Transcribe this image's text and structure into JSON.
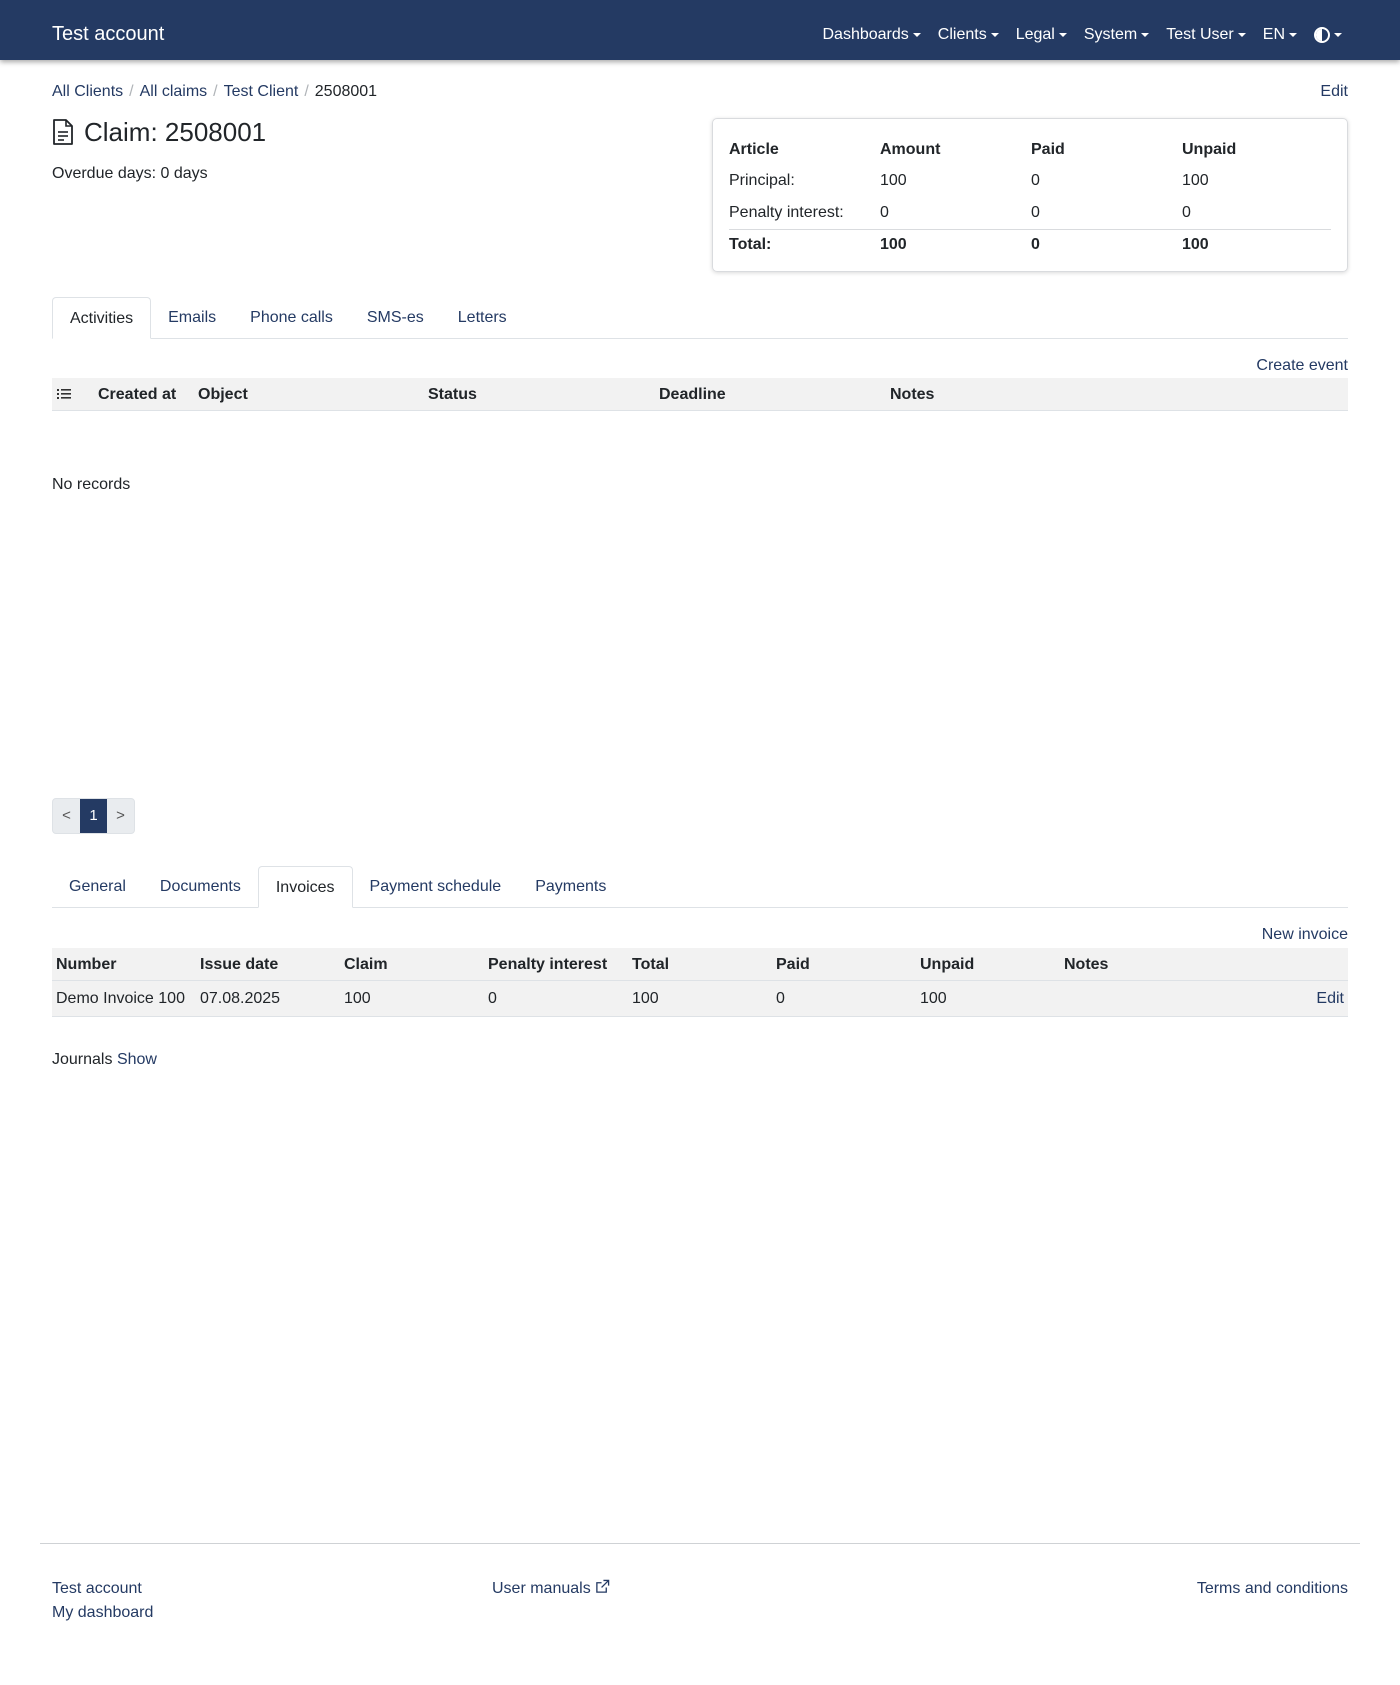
{
  "navbar": {
    "brand": "Test account",
    "items": [
      {
        "label": "Dashboards"
      },
      {
        "label": "Clients"
      },
      {
        "label": "Legal"
      },
      {
        "label": "System"
      },
      {
        "label": "Test User"
      },
      {
        "label": "EN"
      }
    ]
  },
  "breadcrumb": {
    "items": [
      "All Clients",
      "All claims",
      "Test Client"
    ],
    "current": "2508001",
    "separator": "/"
  },
  "edit_label": "Edit",
  "claim": {
    "title": "Claim: 2508001",
    "overdue": "Overdue days: 0 days"
  },
  "summary": {
    "headers": [
      "Article",
      "Amount",
      "Paid",
      "Unpaid"
    ],
    "rows": [
      [
        "Principal:",
        "100",
        "0",
        "100"
      ],
      [
        "Penalty interest:",
        "0",
        "0",
        "0"
      ]
    ],
    "total": [
      "Total:",
      "100",
      "0",
      "100"
    ]
  },
  "activity_tabs": [
    "Activities",
    "Emails",
    "Phone calls",
    "SMS-es",
    "Letters"
  ],
  "create_event_label": "Create event",
  "activity_table": {
    "headers": [
      "Created at",
      "Object",
      "Status",
      "Deadline",
      "Notes"
    ],
    "empty_text": "No records"
  },
  "pager": {
    "prev": "<",
    "current": "1",
    "next": ">"
  },
  "detail_tabs": [
    "General",
    "Documents",
    "Invoices",
    "Payment schedule",
    "Payments"
  ],
  "new_invoice_label": "New invoice",
  "invoice_table": {
    "headers": [
      "Number",
      "Issue date",
      "Claim",
      "Penalty interest",
      "Total",
      "Paid",
      "Unpaid",
      "Notes"
    ],
    "rows": [
      {
        "cells": [
          "Demo Invoice 100",
          "07.08.2025",
          "100",
          "0",
          "100",
          "0",
          "100",
          ""
        ],
        "action": "Edit"
      }
    ]
  },
  "journals": {
    "label": "Journals",
    "link": "Show"
  },
  "footer": {
    "account": "Test account",
    "dashboard": "My dashboard",
    "manuals": "User manuals",
    "terms": "Terms and conditions"
  }
}
